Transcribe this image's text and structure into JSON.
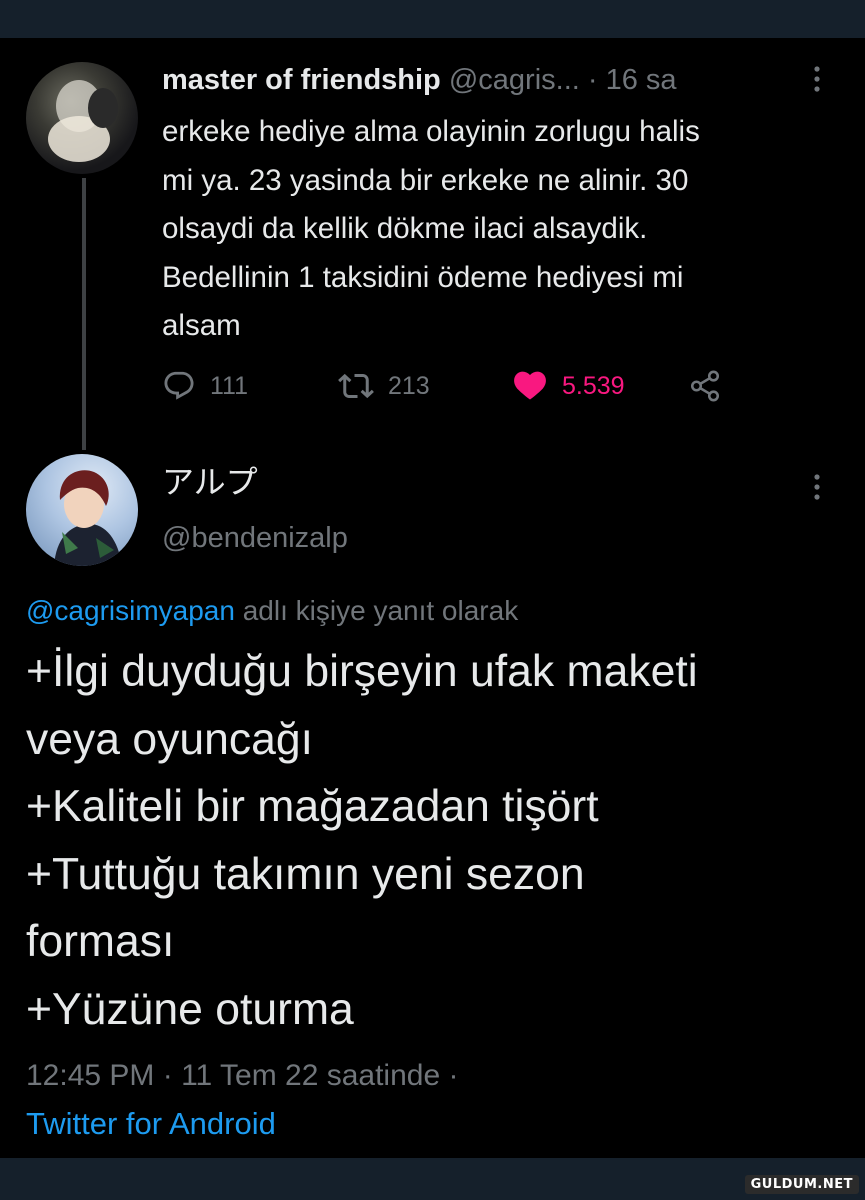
{
  "original_tweet": {
    "author_name": "master of friendship",
    "author_handle": "@cagris...",
    "separator": "·",
    "time": "16 sa",
    "text": "erkeke hediye alma olayinin zorlugu halis\nmi ya. 23 yasinda bir erkeke ne alinir. 30\nolsaydi da kellik dökme ilaci alsaydik.\nBedellinin 1 taksidini ödeme hediyesi mi\nalsam",
    "replies": "111",
    "retweets": "213",
    "likes": "5.539",
    "liked": true
  },
  "reply_tweet": {
    "author_name": "アルプ",
    "author_handle": "@bendenizalp",
    "reply_to_mention": "@cagrisimyapan",
    "reply_to_suffix": " adlı kişiye yanıt olarak",
    "text": "+İlgi duyduğu birşeyin ufak maketi\nveya oyuncağı\n+Kaliteli bir mağazadan tişört\n+Tuttuğu takımın yeni sezon\nforması\n+Yüzüne oturma",
    "timestamp": "12:45 PM · 11 Tem 22 saatinde ·",
    "source": "Twitter for Android"
  },
  "watermark": "GULDUM.NET",
  "icons": {
    "reply": "reply-icon",
    "retweet": "retweet-icon",
    "like": "heart-icon",
    "share": "share-icon",
    "more": "more-icon"
  },
  "colors": {
    "background": "#000000",
    "bar": "#15202b",
    "text": "#e7e9ea",
    "secondary": "#71767b",
    "link": "#1d9bf0",
    "like": "#f91880"
  }
}
